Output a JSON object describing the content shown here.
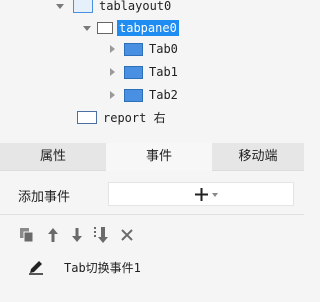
{
  "tree": {
    "nodes": [
      {
        "label": "tablayout0"
      },
      {
        "label": "tabpane0"
      },
      {
        "label": "Tab0"
      },
      {
        "label": "Tab1"
      },
      {
        "label": "Tab2"
      },
      {
        "label": "report 右"
      }
    ]
  },
  "tabs": [
    {
      "label": "属性"
    },
    {
      "label": "事件"
    },
    {
      "label": "移动端"
    }
  ],
  "add_event": {
    "label": "添加事件"
  },
  "events": [
    {
      "label": "Tab切换事件1"
    }
  ],
  "icons": {
    "copy": "copy-icon",
    "up": "arrow-up-icon",
    "down": "arrow-down-icon",
    "move_bottom": "move-to-bottom-icon",
    "delete": "close-icon",
    "edit": "pencil-icon",
    "add": "plus-icon"
  },
  "colors": {
    "selection": "#1e8cf0",
    "tab_icon": "#4a90e2"
  }
}
